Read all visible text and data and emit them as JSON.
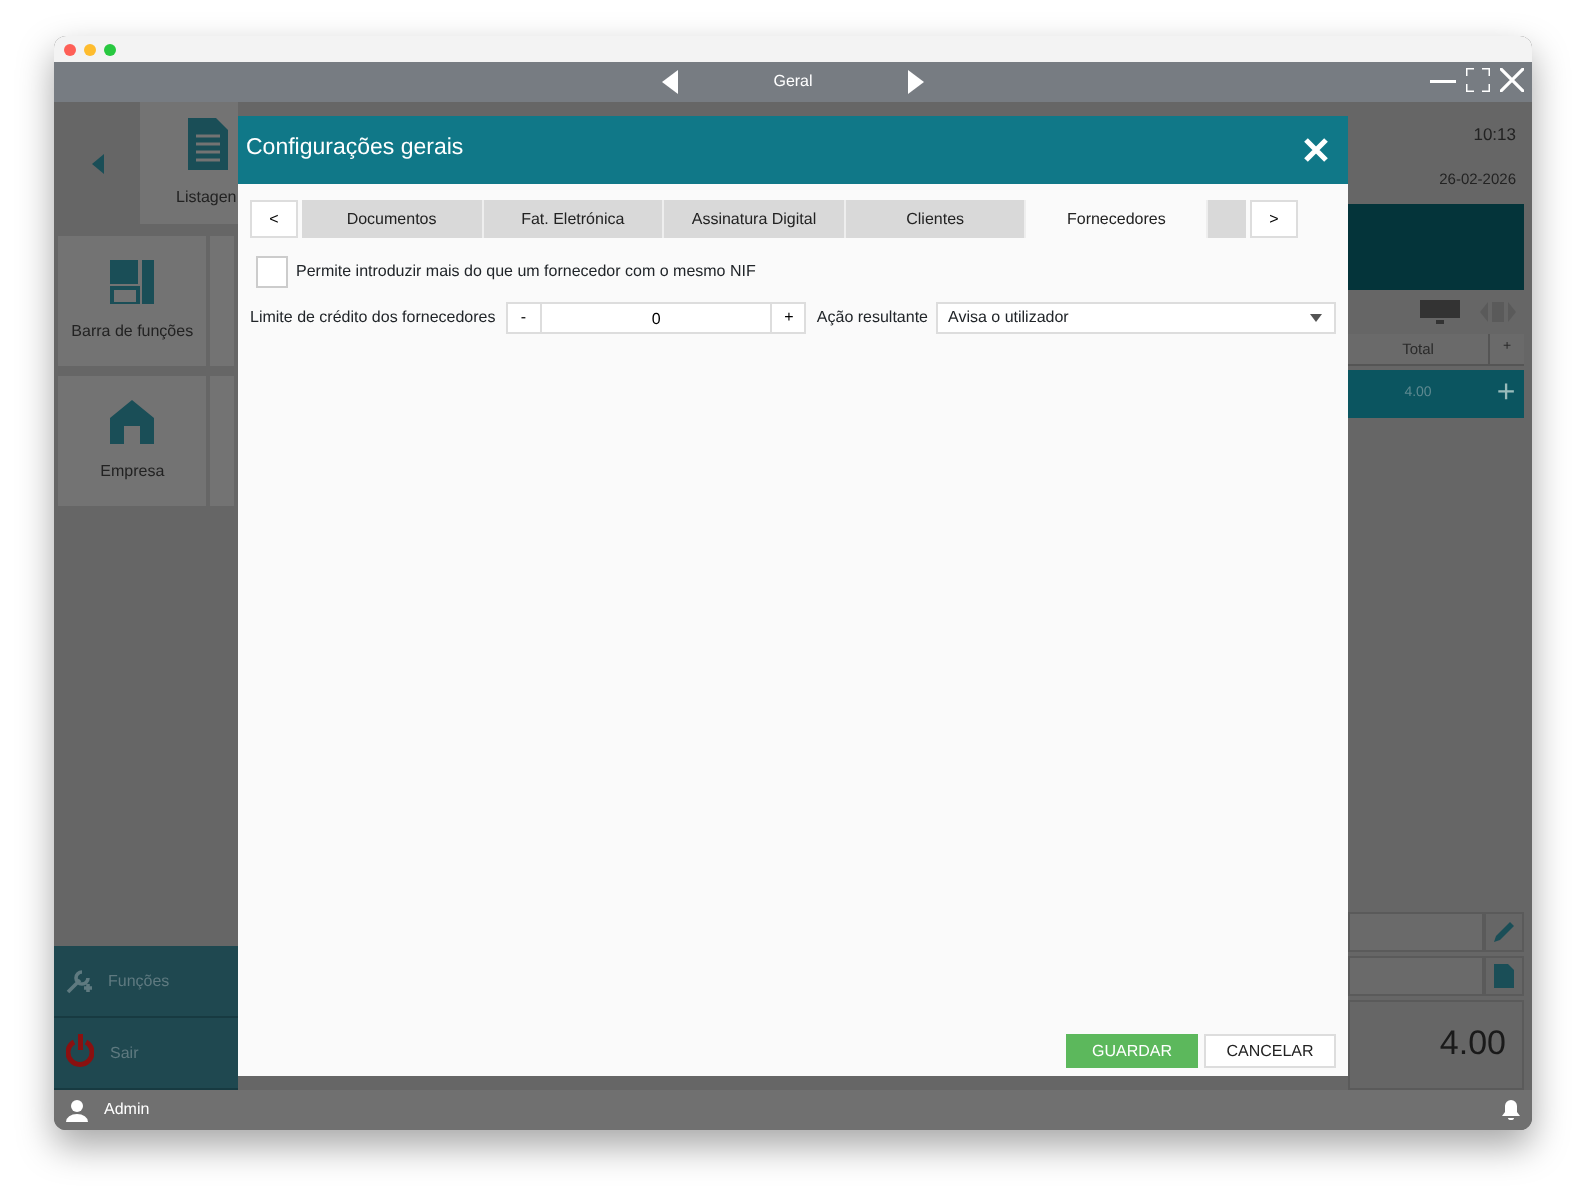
{
  "window": {
    "title": "Geral"
  },
  "background": {
    "tiles": [
      {
        "label": "Listagen"
      },
      {
        "label": "Barra de funções"
      },
      {
        "label": "Empresa"
      }
    ],
    "time": "10:13",
    "date": "26-02-2026",
    "table": {
      "columns": [
        "Total",
        "+"
      ],
      "rows": [
        {
          "total": "4.00",
          "action": "+"
        }
      ]
    },
    "total": "4.00",
    "bottom_tiles": [
      {
        "kind": "functions",
        "label": "Funções"
      },
      {
        "kind": "exit",
        "label": "Sair"
      }
    ]
  },
  "dialog": {
    "title": "Configurações gerais",
    "prev": "<",
    "next": ">",
    "tabs": [
      {
        "label": "Documentos",
        "selected": false
      },
      {
        "label": "Fat. Eletrónica",
        "selected": false
      },
      {
        "label": "Assinatura Digital",
        "selected": false
      },
      {
        "label": "Clientes",
        "selected": false
      },
      {
        "label": "Fornecedores",
        "selected": true
      }
    ],
    "checkbox": {
      "label": "Permite introduzir mais do que um fornecedor com o mesmo NIF",
      "checked": false
    },
    "credit": {
      "label": "Limite de crédito dos fornecedores",
      "minus": "-",
      "value": "0",
      "plus": "+",
      "action_label": "Ação resultante",
      "action_value": "Avisa o utilizador"
    },
    "buttons": [
      {
        "kind": "primary",
        "label": "GUARDAR"
      },
      {
        "kind": "secondary",
        "label": "CANCELAR"
      }
    ]
  },
  "status_bar": {
    "user": "Admin"
  }
}
